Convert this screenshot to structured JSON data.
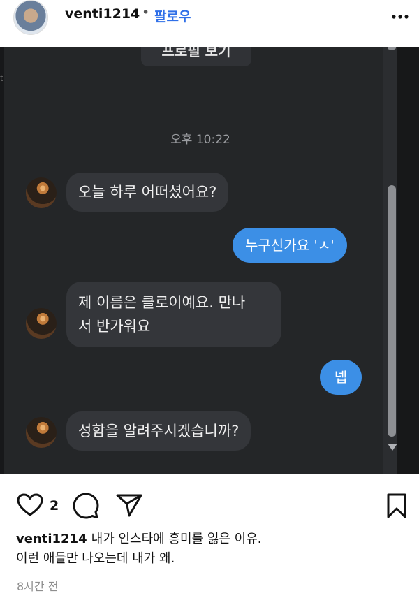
{
  "header": {
    "username": "venti1214",
    "separator": "•",
    "follow_label": "팔로우",
    "more_icon": "more-icon"
  },
  "chat": {
    "profile_button_label": "프로필 보기",
    "timestamp": "오후 10:22",
    "messages": [
      {
        "direction": "in",
        "text_lines": [
          "오늘 하루 어떠셨어요?"
        ]
      },
      {
        "direction": "out",
        "text_lines": [
          "누구신가요 'ㅅ'"
        ]
      },
      {
        "direction": "in",
        "text_lines": [
          "제 이름은 클로이예요. 만나",
          "서 반가워요"
        ]
      },
      {
        "direction": "out",
        "text_lines": [
          "넵"
        ]
      },
      {
        "direction": "in",
        "text_lines": [
          "성함을 알려주시겠습니까?"
        ]
      }
    ],
    "colors": {
      "background": "#242628",
      "incoming_bubble": "#34363a",
      "outgoing_bubble": "#3c8fe6"
    }
  },
  "actions": {
    "like_count": "2",
    "icons": [
      "heart-icon",
      "comment-icon",
      "share-icon",
      "bookmark-icon"
    ]
  },
  "caption": {
    "username": "venti1214",
    "line1": "내가 인스타에 흥미를 잃은 이유.",
    "line2": "이런 애들만 나오는데 내가 왜."
  },
  "time_ago": "8시간 전"
}
